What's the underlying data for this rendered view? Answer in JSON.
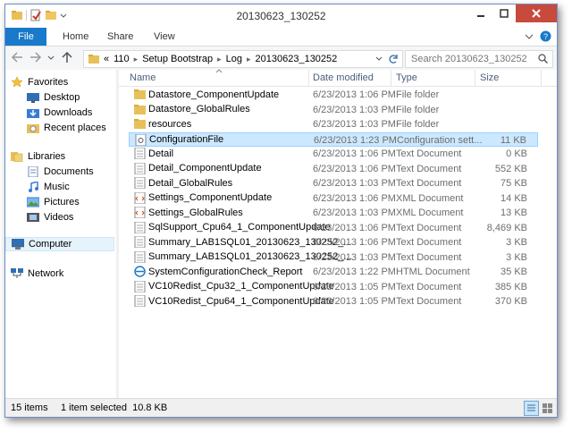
{
  "window": {
    "title": "20130623_130252"
  },
  "ribbon": {
    "tabs": [
      "File",
      "Home",
      "Share",
      "View"
    ]
  },
  "address": {
    "overflow": "«",
    "crumbs": [
      "110",
      "Setup Bootstrap",
      "Log",
      "20130623_130252"
    ]
  },
  "search": {
    "placeholder": "Search 20130623_130252"
  },
  "nav": {
    "favorites": {
      "label": "Favorites",
      "items": [
        "Desktop",
        "Downloads",
        "Recent places"
      ]
    },
    "libraries": {
      "label": "Libraries",
      "items": [
        "Documents",
        "Music",
        "Pictures",
        "Videos"
      ]
    },
    "computer": "Computer",
    "network": "Network"
  },
  "columns": {
    "name": "Name",
    "date": "Date modified",
    "type": "Type",
    "size": "Size"
  },
  "files": [
    {
      "name": "Datastore_ComponentUpdate",
      "date": "6/23/2013 1:06 PM",
      "type": "File folder",
      "size": "",
      "icon": "folder-icon"
    },
    {
      "name": "Datastore_GlobalRules",
      "date": "6/23/2013 1:03 PM",
      "type": "File folder",
      "size": "",
      "icon": "folder-icon"
    },
    {
      "name": "resources",
      "date": "6/23/2013 1:03 PM",
      "type": "File folder",
      "size": "",
      "icon": "folder-icon"
    },
    {
      "name": "ConfigurationFile",
      "date": "6/23/2013 1:23 PM",
      "type": "Configuration sett...",
      "size": "11 KB",
      "icon": "settings-file-icon"
    },
    {
      "name": "Detail",
      "date": "6/23/2013 1:06 PM",
      "type": "Text Document",
      "size": "0 KB",
      "icon": "text-file-icon"
    },
    {
      "name": "Detail_ComponentUpdate",
      "date": "6/23/2013 1:06 PM",
      "type": "Text Document",
      "size": "552 KB",
      "icon": "text-file-icon"
    },
    {
      "name": "Detail_GlobalRules",
      "date": "6/23/2013 1:03 PM",
      "type": "Text Document",
      "size": "75 KB",
      "icon": "text-file-icon"
    },
    {
      "name": "Settings_ComponentUpdate",
      "date": "6/23/2013 1:06 PM",
      "type": "XML Document",
      "size": "14 KB",
      "icon": "xml-file-icon"
    },
    {
      "name": "Settings_GlobalRules",
      "date": "6/23/2013 1:03 PM",
      "type": "XML Document",
      "size": "13 KB",
      "icon": "xml-file-icon"
    },
    {
      "name": "SqlSupport_Cpu64_1_ComponentUpdate",
      "date": "6/23/2013 1:06 PM",
      "type": "Text Document",
      "size": "8,469 KB",
      "icon": "text-file-icon"
    },
    {
      "name": "Summary_LAB1SQL01_20130623_130252_...",
      "date": "6/23/2013 1:06 PM",
      "type": "Text Document",
      "size": "3 KB",
      "icon": "text-file-icon"
    },
    {
      "name": "Summary_LAB1SQL01_20130623_130252_...",
      "date": "6/23/2013 1:03 PM",
      "type": "Text Document",
      "size": "3 KB",
      "icon": "text-file-icon"
    },
    {
      "name": "SystemConfigurationCheck_Report",
      "date": "6/23/2013 1:22 PM",
      "type": "HTML Document",
      "size": "35 KB",
      "icon": "html-file-icon"
    },
    {
      "name": "VC10Redist_Cpu32_1_ComponentUpdate",
      "date": "6/23/2013 1:05 PM",
      "type": "Text Document",
      "size": "385 KB",
      "icon": "text-file-icon"
    },
    {
      "name": "VC10Redist_Cpu64_1_ComponentUpdate",
      "date": "6/23/2013 1:05 PM",
      "type": "Text Document",
      "size": "370 KB",
      "icon": "text-file-icon"
    }
  ],
  "selected_index": 3,
  "status": {
    "count": "15 items",
    "selection": "1 item selected  10.8 KB"
  },
  "colors": {
    "accent": "#1979ca",
    "close": "#c74a3d",
    "selection": "#cce8ff"
  }
}
